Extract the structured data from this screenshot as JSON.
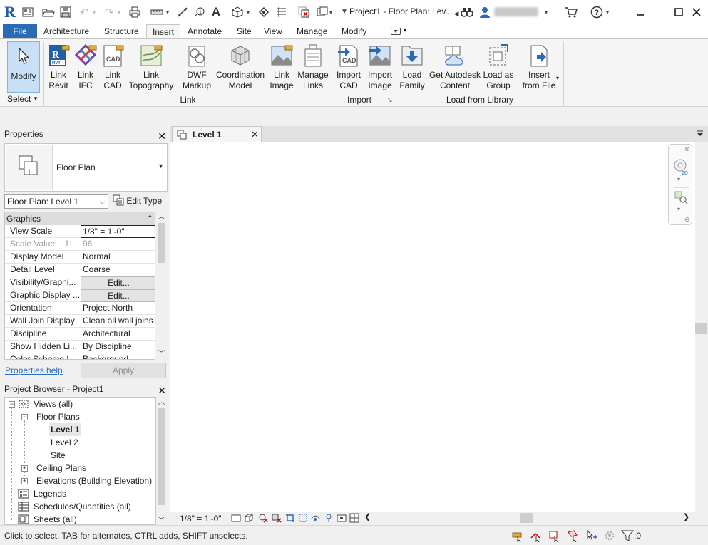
{
  "window": {
    "title": "Project1 - Floor Plan: Lev...",
    "app_icon": "R",
    "quick_access_icons": [
      "open-icon",
      "save-icon",
      "undo-icon",
      "redo-icon",
      "print-icon",
      "measure-icon",
      "dimension-icon",
      "tag-icon",
      "text-icon",
      "3d-view-icon",
      "section-icon",
      "thin-lines-icon",
      "close-hidden-icon",
      "switch-windows-icon"
    ],
    "search_icon": "binoculars-icon",
    "user_icon": "user-icon",
    "cart_icon": "cart-icon",
    "help_icon": "help-icon"
  },
  "ribbon": {
    "file_tab": "File",
    "tabs": [
      "Architecture",
      "Structure",
      "Insert",
      "Annotate",
      "Site",
      "View",
      "Manage",
      "Modify"
    ],
    "active_tab": "Insert",
    "panels": {
      "select": {
        "title": "Select",
        "buttons": [
          {
            "label": "Modify",
            "icon": "cursor-icon"
          }
        ]
      },
      "link": {
        "title": "Link",
        "buttons": [
          {
            "label": "Link\nRevit",
            "icon": "link-revit-icon"
          },
          {
            "label": "Link\nIFC",
            "icon": "link-ifc-icon"
          },
          {
            "label": "Link\nCAD",
            "icon": "link-cad-icon"
          },
          {
            "label": "Link\nTopography",
            "icon": "link-topography-icon"
          },
          {
            "label": "DWF\nMarkup",
            "icon": "dwf-markup-icon"
          },
          {
            "label": "Coordination\nModel",
            "icon": "coordination-model-icon"
          },
          {
            "label": "Link\nImage",
            "icon": "link-image-icon"
          },
          {
            "label": "Manage\nLinks",
            "icon": "manage-links-icon"
          }
        ]
      },
      "import": {
        "title": "Import",
        "buttons": [
          {
            "label": "Import\nCAD",
            "icon": "import-cad-icon"
          },
          {
            "label": "Import\nImage",
            "icon": "import-image-icon"
          }
        ]
      },
      "load_from_library": {
        "title": "Load from Library",
        "buttons": [
          {
            "label": "Load\nFamily",
            "icon": "load-family-icon"
          },
          {
            "label": "Get Autodesk\nContent",
            "icon": "autodesk-content-icon"
          },
          {
            "label": "Load as\nGroup",
            "icon": "load-group-icon"
          },
          {
            "label": "Insert\nfrom File",
            "icon": "insert-file-icon"
          }
        ]
      }
    }
  },
  "properties": {
    "title": "Properties",
    "type_name": "Floor Plan",
    "instance_selector": "Floor Plan: Level 1",
    "edit_type": "Edit Type",
    "group": "Graphics",
    "rows": [
      {
        "name": "View Scale",
        "value": "1/8\" = 1'-0\""
      },
      {
        "name": "Scale Value    1:",
        "value": "96"
      },
      {
        "name": "Display Model",
        "value": "Normal"
      },
      {
        "name": "Detail Level",
        "value": "Coarse"
      },
      {
        "name": "Visibility/Graphi...",
        "value": "Edit..."
      },
      {
        "name": "Graphic Display ...",
        "value": "Edit..."
      },
      {
        "name": "Orientation",
        "value": "Project North"
      },
      {
        "name": "Wall Join Display",
        "value": "Clean all wall joins"
      },
      {
        "name": "Discipline",
        "value": "Architectural"
      },
      {
        "name": "Show Hidden Li...",
        "value": "By Discipline"
      },
      {
        "name": "Color Scheme L...",
        "value": "Background"
      }
    ],
    "help_link": "Properties help",
    "apply": "Apply"
  },
  "project_browser": {
    "title": "Project Browser - Project1",
    "nodes": {
      "views": "Views (all)",
      "floor_plans": "Floor Plans",
      "level1": "Level 1",
      "level2": "Level 2",
      "site": "Site",
      "ceiling_plans": "Ceiling Plans",
      "elevations": "Elevations (Building Elevation)",
      "legends": "Legends",
      "schedules": "Schedules/Quantities (all)",
      "sheets": "Sheets (all)"
    }
  },
  "view": {
    "tab_label": "Level 1",
    "scale": "1/8\" = 1'-0\""
  },
  "status": {
    "text": "Click to select, TAB for alternates, CTRL adds, SHIFT unselects.",
    "filter_count": ":0"
  },
  "colors": {
    "accent": "#2b6bb6",
    "selected_button": "#c8e0f5",
    "link": "#2d6ec2"
  }
}
